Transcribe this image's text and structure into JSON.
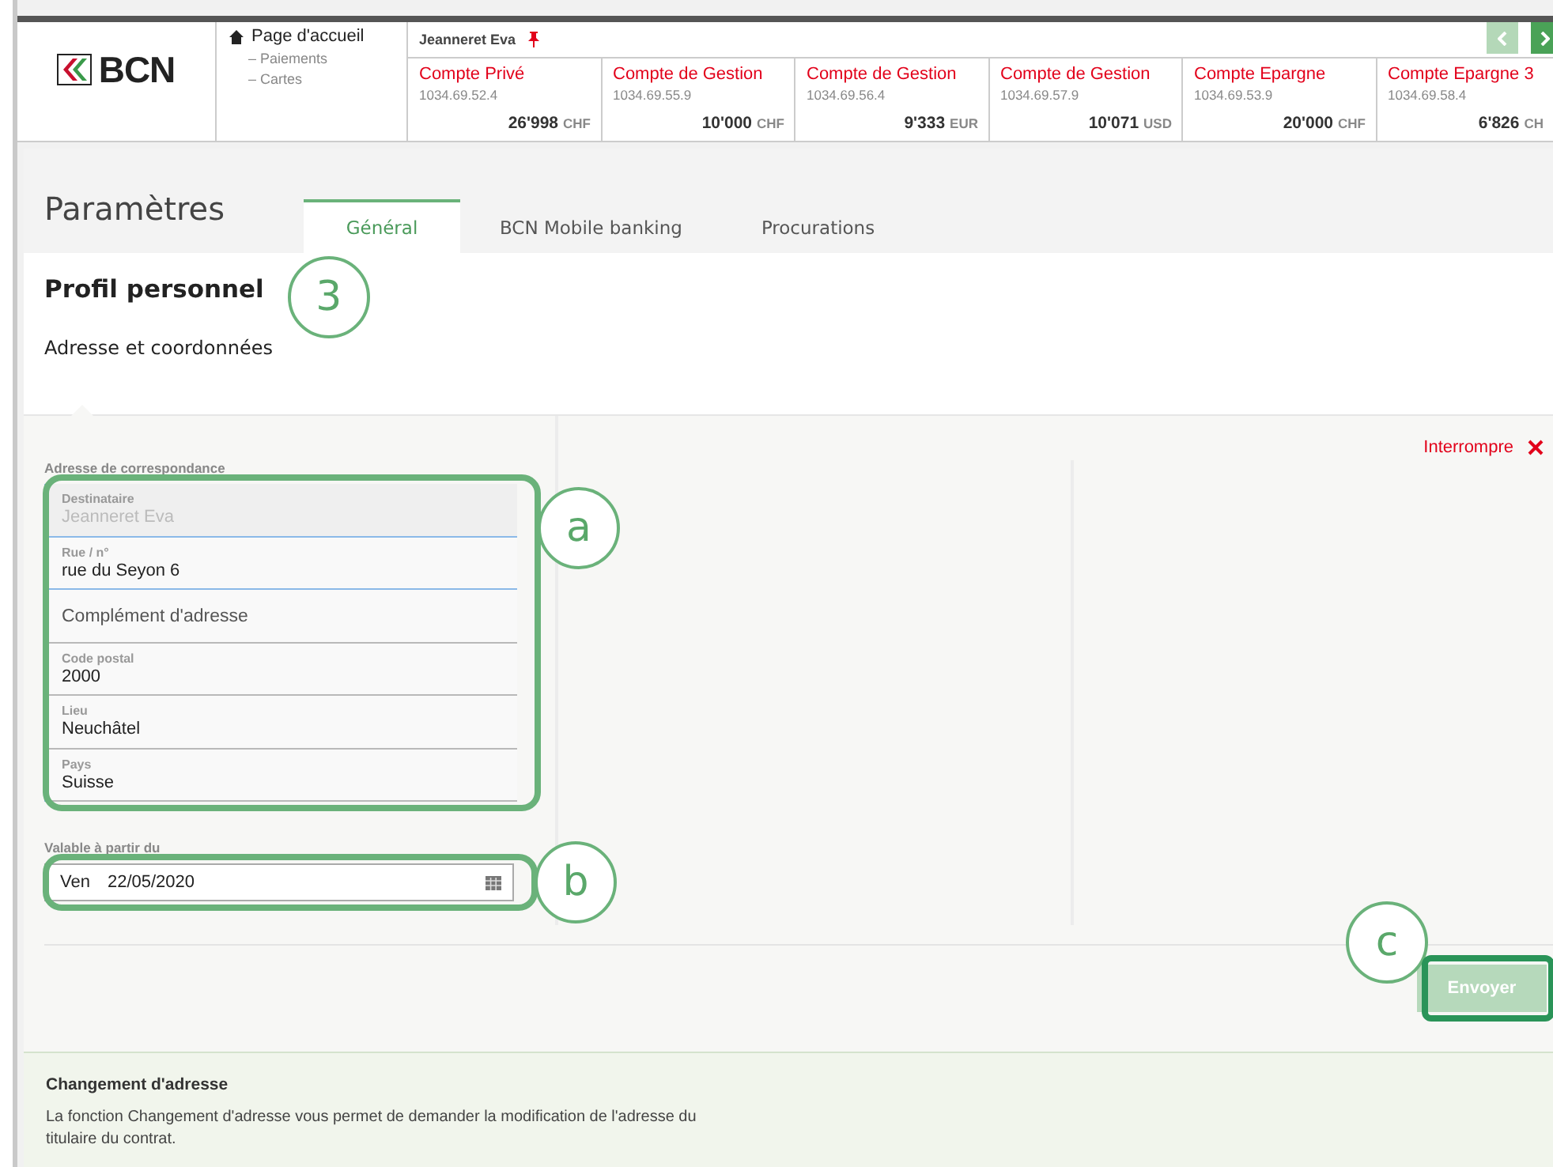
{
  "header": {
    "logo_text": "BCN",
    "nav": {
      "home": "Page d'accueil",
      "links": [
        "– Paiements",
        "– Cartes"
      ]
    },
    "client": "Jeanneret Eva",
    "accounts": [
      {
        "name": "Compte Privé",
        "number": "1034.69.52.4",
        "amount": "26'998",
        "currency": "CHF"
      },
      {
        "name": "Compte de Gestion",
        "number": "1034.69.55.9",
        "amount": "10'000",
        "currency": "CHF"
      },
      {
        "name": "Compte de Gestion",
        "number": "1034.69.56.4",
        "amount": "9'333",
        "currency": "EUR"
      },
      {
        "name": "Compte de Gestion",
        "number": "1034.69.57.9",
        "amount": "10'071",
        "currency": "USD"
      },
      {
        "name": "Compte Epargne",
        "number": "1034.69.53.9",
        "amount": "20'000",
        "currency": "CHF"
      },
      {
        "name": "Compte Epargne 3",
        "number": "1034.69.58.4",
        "amount": "6'826",
        "currency": "CH"
      }
    ]
  },
  "page": {
    "title": "Paramètres",
    "tabs": [
      {
        "label": "Général",
        "selected": true
      },
      {
        "label": "BCN Mobile banking",
        "selected": false
      },
      {
        "label": "Procurations",
        "selected": false
      }
    ],
    "heading": "Profil personnel",
    "subheading": "Adresse et coordonnées"
  },
  "form": {
    "group_label": "Adresse de correspondance",
    "cancel": "Interrompre",
    "fields": [
      {
        "label": "Destinataire",
        "value": "Jeanneret Eva",
        "disabled": true
      },
      {
        "label": "Rue / n°",
        "value": "rue du Seyon 6",
        "disabled": false
      },
      {
        "placeholder": "Complément d'adresse",
        "disabled": false
      },
      {
        "label": "Code postal",
        "value": "2000",
        "disabled": false
      },
      {
        "label": "Lieu",
        "value": "Neuchâtel",
        "disabled": false
      },
      {
        "label": "Pays",
        "value": "Suisse",
        "disabled": false
      }
    ],
    "date": {
      "label": "Valable à partir du",
      "weekday": "Ven",
      "value": "22/05/2020"
    },
    "submit": {
      "label": "Envoyer",
      "disabled": true
    }
  },
  "info": {
    "title": "Changement d'adresse",
    "text": "La fonction Changement d'adresse vous permet de demander la modification de l'adresse du titulaire du contrat."
  },
  "annotations": [
    {
      "kind": "circle",
      "label": "3"
    },
    {
      "kind": "circle",
      "label": "a"
    },
    {
      "kind": "circle",
      "label": "b"
    },
    {
      "kind": "circle",
      "label": "c"
    }
  ]
}
